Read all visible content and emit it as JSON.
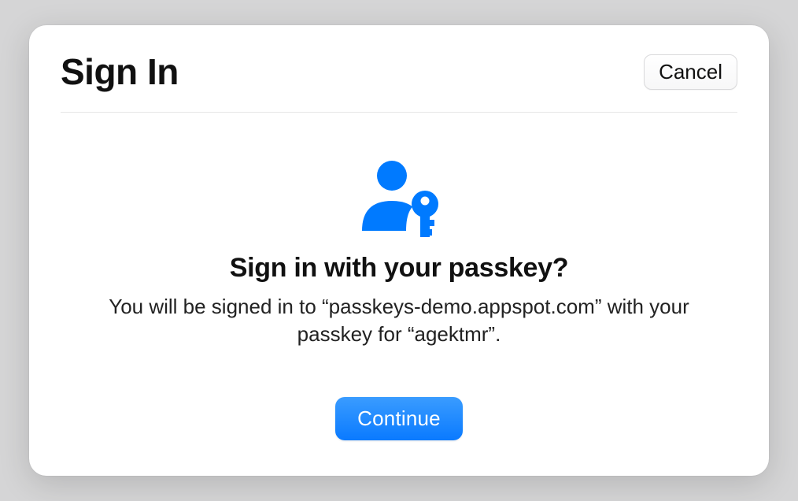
{
  "dialog": {
    "title": "Sign In",
    "cancel_label": "Cancel",
    "heading": "Sign in with your passkey?",
    "description": "You will be signed in to “passkeys-demo.appspot.com” with your passkey for “agektmr”.",
    "continue_label": "Continue",
    "accent_color": "#007aff"
  }
}
